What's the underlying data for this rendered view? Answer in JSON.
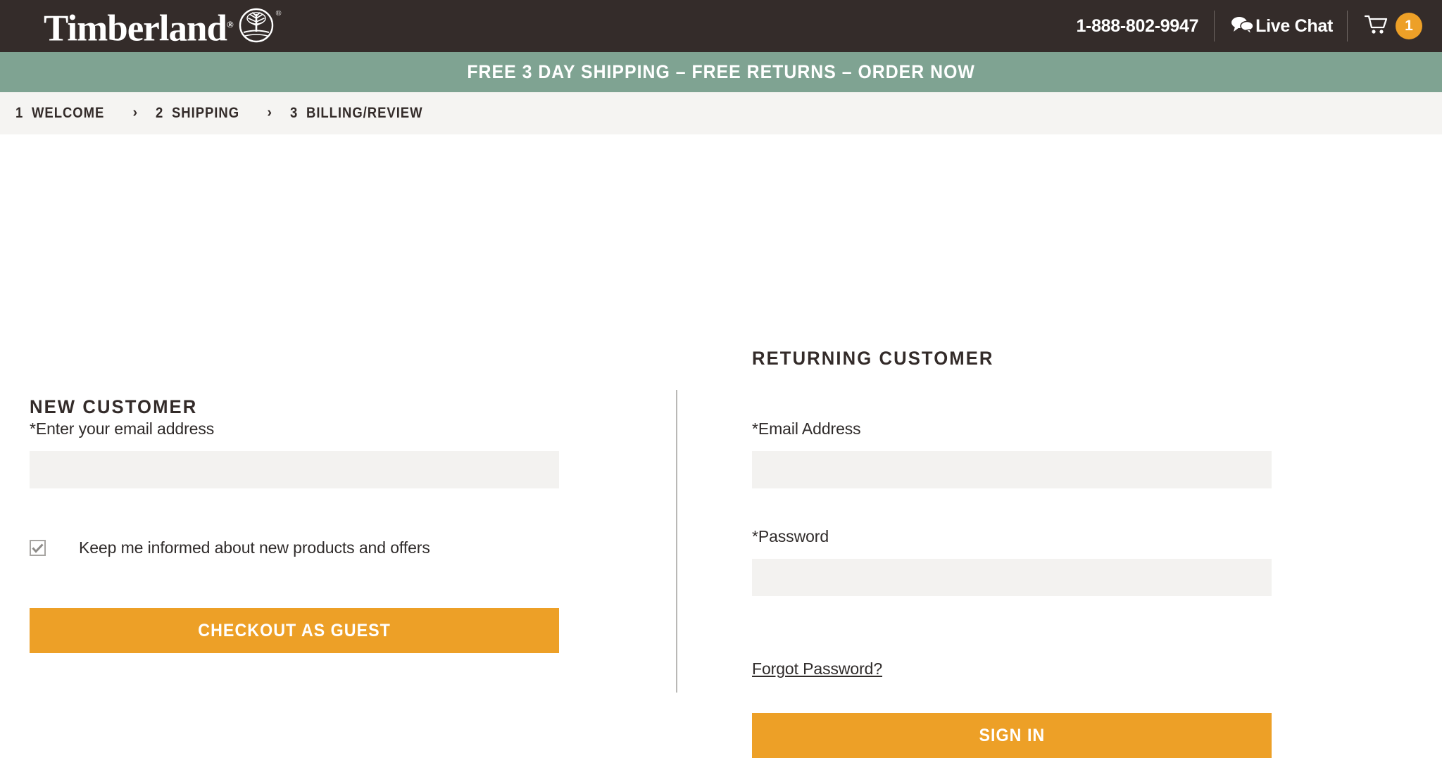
{
  "header": {
    "logo_text": "Timberland",
    "logo_registered": "®",
    "logo_emblem_icon": "tree-circle-emblem",
    "phone": "1-888-802-9947",
    "live_chat_label": "Live Chat",
    "live_chat_icon": "speech-bubbles-icon",
    "cart_icon": "shopping-cart-icon",
    "cart_count": "1",
    "bg_color": "#342C2A",
    "badge_color": "#EDA027"
  },
  "promo": {
    "text": "FREE 3 DAY SHIPPING – FREE RETURNS – ORDER NOW",
    "bg_color": "#7FA392"
  },
  "steps": {
    "separator": "›",
    "items": [
      {
        "num": "1",
        "label": "WELCOME"
      },
      {
        "num": "2",
        "label": "SHIPPING"
      },
      {
        "num": "3",
        "label": "BILLING/REVIEW"
      }
    ]
  },
  "new_customer": {
    "title": "NEW CUSTOMER",
    "email_label": "*Enter your email address",
    "email_value": "",
    "email_placeholder": "",
    "checkbox_label": "Keep me informed about new products and offers",
    "checkbox_checked": true,
    "button_label": "CHECKOUT AS GUEST"
  },
  "returning_customer": {
    "title": "RETURNING CUSTOMER",
    "email_label": "*Email Address",
    "email_value": "",
    "email_placeholder": "",
    "password_label": "*Password",
    "password_value": "",
    "password_placeholder": "",
    "forgot_link": "Forgot Password?",
    "button_label": "SIGN IN"
  },
  "colors": {
    "accent_orange": "#EDA027",
    "field_gray": "#F3F2F0",
    "text_dark": "#332B29"
  }
}
